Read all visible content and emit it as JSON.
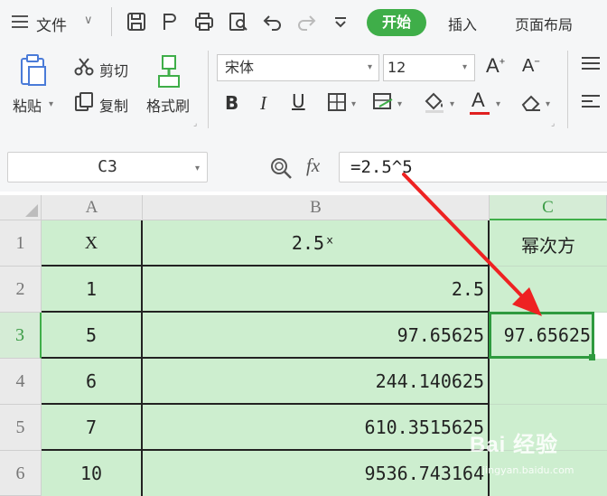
{
  "menubar": {
    "file_label": "文件",
    "tabs": [
      {
        "label": "开始",
        "active": true
      },
      {
        "label": "插入",
        "active": false
      },
      {
        "label": "页面布局",
        "active": false
      }
    ],
    "accent_color": "#3fae49"
  },
  "ribbon": {
    "paste_label": "粘贴",
    "cut_label": "剪切",
    "copy_label": "复制",
    "format_painter_label": "格式刷",
    "font_name": "宋体",
    "font_size": "12"
  },
  "formula_bar": {
    "cell_ref": "C3",
    "fx_label": "fx",
    "formula": "=2.5^5"
  },
  "sheet": {
    "columns": [
      "A",
      "B",
      "C"
    ],
    "rows": [
      {
        "num": "1",
        "a": "X",
        "b": "2.5ˣ",
        "c": "幂次方"
      },
      {
        "num": "2",
        "a": "1",
        "b": "2.5",
        "c": ""
      },
      {
        "num": "3",
        "a": "5",
        "b": "97.65625",
        "c": "97.65625"
      },
      {
        "num": "4",
        "a": "6",
        "b": "244.140625",
        "c": ""
      },
      {
        "num": "5",
        "a": "7",
        "b": "610.3515625",
        "c": ""
      },
      {
        "num": "6",
        "a": "10",
        "b": "9536.743164",
        "c": ""
      }
    ],
    "selected_cell": "C3",
    "fill_color": "#cdeecf"
  },
  "watermark": "Bai 经验"
}
